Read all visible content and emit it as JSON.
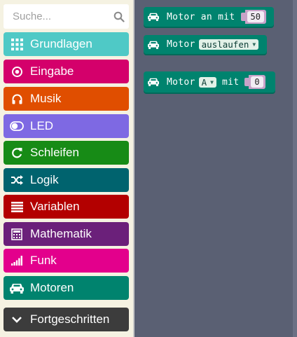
{
  "search": {
    "placeholder": "Suche..."
  },
  "toolbox": {
    "categories": [
      {
        "label": "Grundlagen",
        "icon": "grid-icon",
        "color": "#4fc9c6"
      },
      {
        "label": "Eingabe",
        "icon": "radio-target-icon",
        "color": "#d4006b"
      },
      {
        "label": "Musik",
        "icon": "headphones-icon",
        "color": "#e04e00"
      },
      {
        "label": "LED",
        "icon": "toggle-icon",
        "color": "#7e69e3"
      },
      {
        "label": "Schleifen",
        "icon": "refresh-icon",
        "color": "#178b16"
      },
      {
        "label": "Logik",
        "icon": "shuffle-icon",
        "color": "#00636e"
      },
      {
        "label": "Variablen",
        "icon": "list-icon",
        "color": "#b30000"
      },
      {
        "label": "Mathematik",
        "icon": "calculator-icon",
        "color": "#6b207a"
      },
      {
        "label": "Funk",
        "icon": "signal-bars-icon",
        "color": "#e3008c"
      },
      {
        "label": "Motoren",
        "icon": "car-icon",
        "color": "#00836e"
      }
    ],
    "advanced": {
      "label": "Fortgeschritten",
      "icon": "chevron-down-icon",
      "color": "#3c3c3c"
    }
  },
  "workspace": {
    "blocks": [
      {
        "text": "Motor an mit",
        "value": "50",
        "icon": "car-icon"
      },
      {
        "text": "Motor",
        "dropdown": "auslaufen",
        "icon": "car-icon"
      },
      {
        "text": "Motor",
        "dropdown": "A",
        "text2": "mit",
        "value": "0",
        "icon": "car-icon"
      }
    ]
  }
}
